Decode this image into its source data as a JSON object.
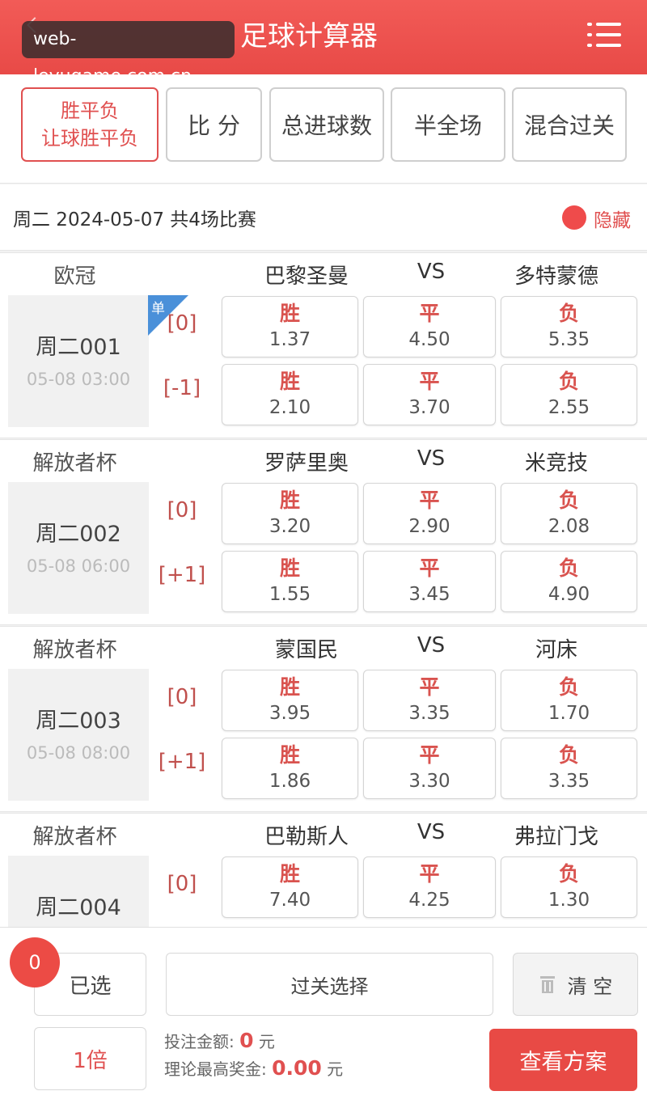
{
  "header": {
    "watermark": "web-leyugame.com.cn",
    "title": "足球计算器"
  },
  "tabs": [
    {
      "line1": "胜平负",
      "line2": "让球胜平负",
      "active": true
    },
    {
      "label": "比 分"
    },
    {
      "label": "总进球数"
    },
    {
      "label": "半全场"
    },
    {
      "label": "混合过关"
    }
  ],
  "info": {
    "text": "周二 2024-05-07 共4场比赛",
    "hide_label": "隐藏"
  },
  "labels": {
    "win": "胜",
    "draw": "平",
    "lose": "负",
    "vs": "VS",
    "dan": "单"
  },
  "matches": [
    {
      "league": "欧冠",
      "home": "巴黎圣曼",
      "away": "多特蒙德",
      "no": "周二001",
      "time": "05-08 03:00",
      "rows": [
        {
          "handicap": "[0]",
          "win": "1.37",
          "draw": "4.50",
          "lose": "5.35"
        },
        {
          "handicap": "[-1]",
          "win": "2.10",
          "draw": "3.70",
          "lose": "2.55"
        }
      ]
    },
    {
      "league": "解放者杯",
      "home": "罗萨里奥",
      "away": "米竞技",
      "no": "周二002",
      "time": "05-08 06:00",
      "rows": [
        {
          "handicap": "[0]",
          "win": "3.20",
          "draw": "2.90",
          "lose": "2.08"
        },
        {
          "handicap": "[+1]",
          "win": "1.55",
          "draw": "3.45",
          "lose": "4.90"
        }
      ]
    },
    {
      "league": "解放者杯",
      "home": "蒙国民",
      "away": "河床",
      "no": "周二003",
      "time": "05-08 08:00",
      "rows": [
        {
          "handicap": "[0]",
          "win": "3.95",
          "draw": "3.35",
          "lose": "1.70"
        },
        {
          "handicap": "[+1]",
          "win": "1.86",
          "draw": "3.30",
          "lose": "3.35"
        }
      ]
    },
    {
      "league": "解放者杯",
      "home": "巴勒斯人",
      "away": "弗拉门戈",
      "no": "周二004",
      "rows": [
        {
          "handicap": "[0]",
          "win": "7.40",
          "draw": "4.25",
          "lose": "1.30"
        }
      ]
    }
  ],
  "footer": {
    "count": "0",
    "selected_label": "已选",
    "pass_select": "过关选择",
    "clear_label": "清 空",
    "multiplier": "1倍",
    "bet_amount_label": "投注金额:",
    "bet_amount": "0",
    "max_prize_label": "理论最高奖金:",
    "max_prize": "0.00",
    "unit": "元",
    "view_plan": "查看方案"
  }
}
